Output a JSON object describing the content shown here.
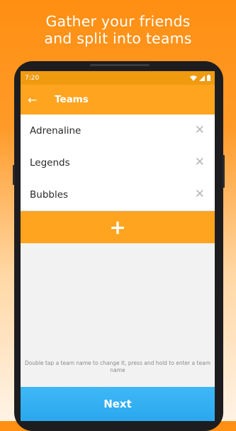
{
  "headline": {
    "line1": "Gather your friends",
    "line2": "and split into teams"
  },
  "status": {
    "time": "7:20",
    "icons": [
      "wifi-icon",
      "signal-icon",
      "battery-icon"
    ]
  },
  "appbar": {
    "back_icon": "back-arrow-icon",
    "title": "Teams"
  },
  "teams": [
    {
      "name": "Adrenaline"
    },
    {
      "name": "Legends"
    },
    {
      "name": "Bubbles"
    }
  ],
  "add_button": {
    "label": "+"
  },
  "hint": "Double tap a team name to change it, press and hold to enter a team name",
  "next_button": {
    "label": "Next"
  },
  "colors": {
    "accent_orange": "#ffa41f",
    "status_orange": "#f09a10",
    "next_blue": "#2aa7ef"
  }
}
